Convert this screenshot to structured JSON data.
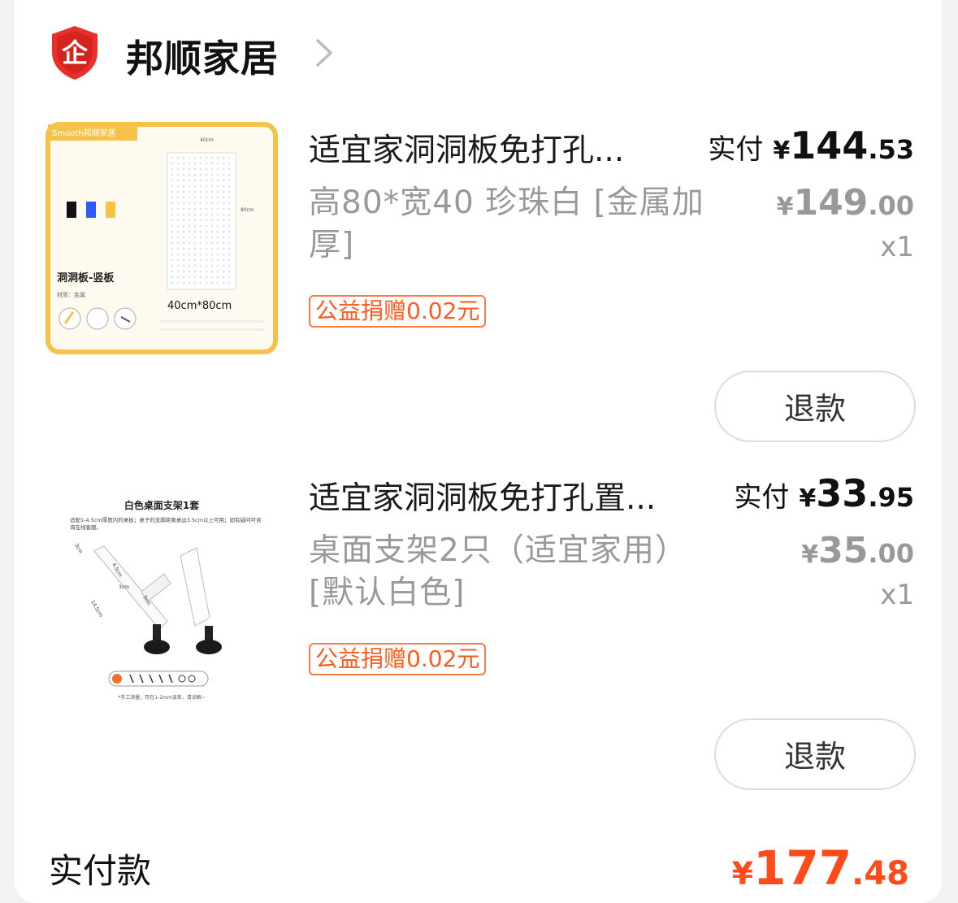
{
  "shop": {
    "name": "邦顺家居",
    "logo_glyph": "企",
    "logo_color": "#e8302b"
  },
  "items": [
    {
      "title": "适宜家洞洞板免打孔...",
      "spec": "高80*宽40 珍珠白 [金属加厚]",
      "donation": "公益捐赠0.02元",
      "paid_label": "实付",
      "currency": "¥",
      "paid_int": "144",
      "paid_dec": ".53",
      "orig_int": "149",
      "orig_dec": ".00",
      "qty": "x1",
      "refund_label": "退款",
      "thumb": {
        "brand": "Smooth邦顺家居",
        "width_label": "40cm",
        "height_label": "80cm",
        "product_label": "洞洞板-竖板",
        "material": "材质：金属",
        "size_text": "40cm*80cm"
      }
    },
    {
      "title": "适宜家洞洞板免打孔置...",
      "spec": "桌面支架2只（适宜家用）[默认白色]",
      "donation": "公益捐赠0.02元",
      "paid_label": "实付",
      "currency": "¥",
      "paid_int": "33",
      "paid_dec": ".95",
      "orig_int": "35",
      "orig_dec": ".00",
      "qty": "x1",
      "refund_label": "退款",
      "thumb": {
        "heading": "白色桌面支架1套",
        "note": "适配1-4.5cm厚度内的桌板；桌子的支脚距离桌边3.5cm以上可用；如有疑问可咨询在线客服。",
        "dim_1": "3cm",
        "dim_2": "4.5cm",
        "dim_3": "3cm",
        "dim_4": "5cm",
        "dim_5": "14.5cm",
        "footnote": "*手工测量，存在1-2mm误差，请谅解~"
      }
    }
  ],
  "total": {
    "label": "实付款",
    "currency": "¥",
    "int": "177",
    "dec": ".48",
    "color": "#ff4a1a"
  }
}
